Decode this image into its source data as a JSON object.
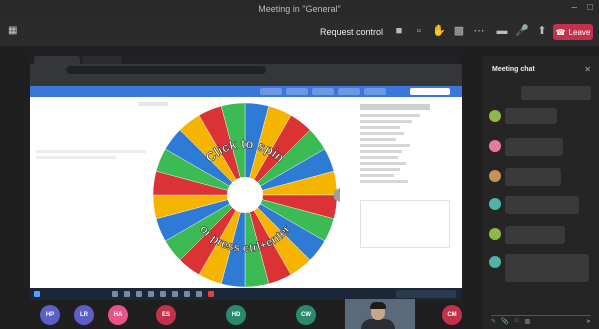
{
  "window": {
    "title": "Meeting in \"General\""
  },
  "toolbar": {
    "left_label": "",
    "request_control": "Request control",
    "leave": "Leave"
  },
  "wheel": {
    "center_top": "Click to spin",
    "center_bottom": "or press ctrl+enter",
    "segments": [
      {
        "color": "#2e7bd6",
        "label": ""
      },
      {
        "color": "#f4b400",
        "label": ""
      },
      {
        "color": "#db3236",
        "label": ""
      },
      {
        "color": "#3cba54",
        "label": ""
      },
      {
        "color": "#2e7bd6",
        "label": ""
      },
      {
        "color": "#f4b400",
        "label": ""
      },
      {
        "color": "#db3236",
        "label": ""
      },
      {
        "color": "#3cba54",
        "label": ""
      },
      {
        "color": "#2e7bd6",
        "label": ""
      },
      {
        "color": "#f4b400",
        "label": ""
      },
      {
        "color": "#db3236",
        "label": ""
      },
      {
        "color": "#3cba54",
        "label": ""
      },
      {
        "color": "#2e7bd6",
        "label": ""
      },
      {
        "color": "#f4b400",
        "label": ""
      },
      {
        "color": "#db3236",
        "label": ""
      },
      {
        "color": "#3cba54",
        "label": ""
      },
      {
        "color": "#2e7bd6",
        "label": ""
      },
      {
        "color": "#f4b400",
        "label": ""
      },
      {
        "color": "#db3236",
        "label": ""
      },
      {
        "color": "#3cba54",
        "label": ""
      },
      {
        "color": "#2e7bd6",
        "label": ""
      },
      {
        "color": "#f4b400",
        "label": ""
      },
      {
        "color": "#db3236",
        "label": ""
      },
      {
        "color": "#3cba54",
        "label": ""
      }
    ]
  },
  "chat": {
    "title": "Meeting chat",
    "messages": [
      {
        "name": "",
        "text": "",
        "avatar_color": "#8fb84a"
      },
      {
        "name": "",
        "text": "",
        "avatar_color": "#e87aa0"
      },
      {
        "name": "",
        "text": "",
        "avatar_color": "#c9905a"
      },
      {
        "name": "",
        "text": "",
        "avatar_color": "#4fb3a8"
      },
      {
        "name": "",
        "text": "",
        "avatar_color": "#8fb84a"
      },
      {
        "name": "",
        "text": "",
        "avatar_color": "#4fb3a8"
      }
    ],
    "compose_placeholder": ""
  },
  "gallery": {
    "participants": [
      {
        "initials": "HP",
        "color": "#5b5fc7"
      },
      {
        "initials": "LR",
        "color": "#5b5fc7"
      },
      {
        "initials": "HA",
        "color": "#e8538a"
      },
      {
        "initials": "ES",
        "color": "#c4314b"
      },
      {
        "initials": "HD",
        "color": "#2a8a6e"
      },
      {
        "initials": "CW",
        "color": "#2a8a6e"
      },
      {
        "initials": "CM",
        "color": "#c4314b"
      }
    ]
  }
}
